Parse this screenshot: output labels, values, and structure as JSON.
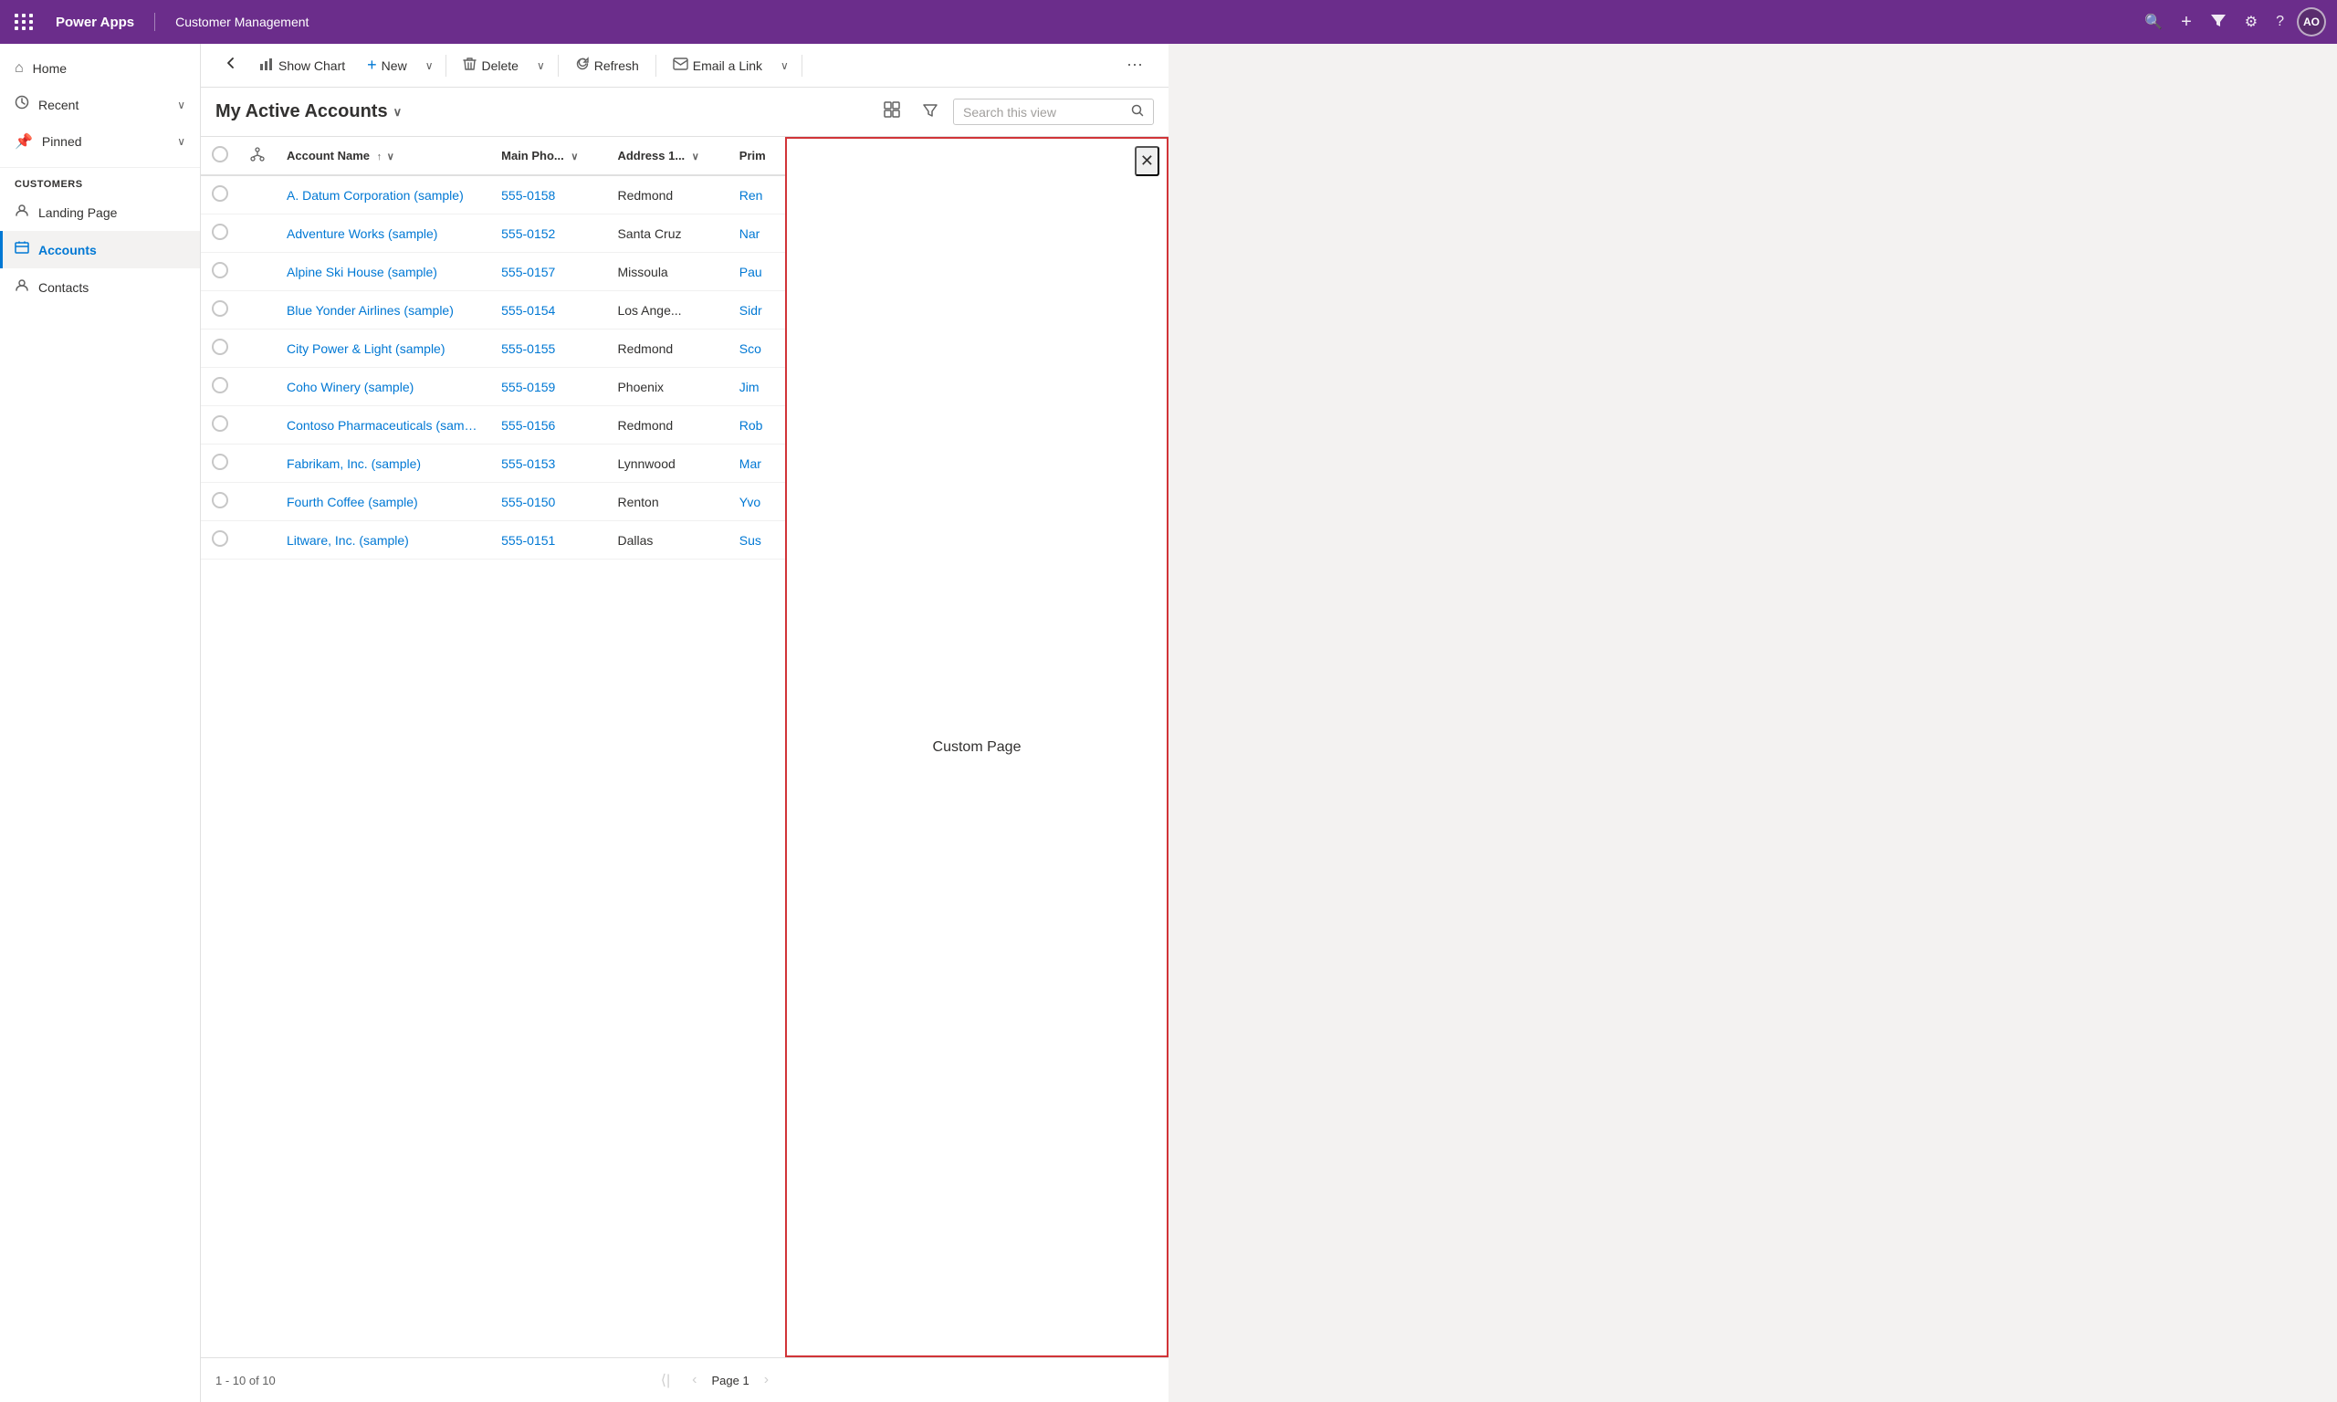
{
  "topBar": {
    "appName": "Power Apps",
    "moduleName": "Customer Management",
    "avatarInitials": "AO",
    "icons": {
      "search": "🔍",
      "add": "+",
      "filter": "⧩",
      "settings": "⚙",
      "help": "?"
    }
  },
  "sidebar": {
    "navItems": [
      {
        "id": "home",
        "label": "Home",
        "icon": "⌂"
      },
      {
        "id": "recent",
        "label": "Recent",
        "icon": "🕐",
        "hasChevron": true
      },
      {
        "id": "pinned",
        "label": "Pinned",
        "icon": "📌",
        "hasChevron": true
      }
    ],
    "sectionLabel": "Customers",
    "subItems": [
      {
        "id": "landing-page",
        "label": "Landing Page",
        "icon": "👤"
      },
      {
        "id": "accounts",
        "label": "Accounts",
        "icon": "📋",
        "active": true
      },
      {
        "id": "contacts",
        "label": "Contacts",
        "icon": "👤"
      }
    ]
  },
  "commandBar": {
    "backLabel": "←",
    "showChartLabel": "Show Chart",
    "newLabel": "New",
    "deleteLabel": "Delete",
    "refreshLabel": "Refresh",
    "emailLinkLabel": "Email a Link",
    "moreLabel": "⋯"
  },
  "viewHeader": {
    "title": "My Active Accounts",
    "chevron": "∨",
    "searchPlaceholder": "Search this view"
  },
  "table": {
    "columns": [
      {
        "id": "check",
        "label": "",
        "type": "check"
      },
      {
        "id": "hier",
        "label": "",
        "type": "hier"
      },
      {
        "id": "accountName",
        "label": "Account Name",
        "sortable": true,
        "sortDir": "asc"
      },
      {
        "id": "mainPhone",
        "label": "Main Pho...",
        "sortable": true
      },
      {
        "id": "address1",
        "label": "Address 1...",
        "sortable": true
      },
      {
        "id": "primary",
        "label": "Prim",
        "sortable": false
      }
    ],
    "rows": [
      {
        "id": 1,
        "accountName": "A. Datum Corporation (sample)",
        "mainPhone": "555-0158",
        "address1": "Redmond",
        "primary": "Ren"
      },
      {
        "id": 2,
        "accountName": "Adventure Works (sample)",
        "mainPhone": "555-0152",
        "address1": "Santa Cruz",
        "primary": "Nar"
      },
      {
        "id": 3,
        "accountName": "Alpine Ski House (sample)",
        "mainPhone": "555-0157",
        "address1": "Missoula",
        "primary": "Pau"
      },
      {
        "id": 4,
        "accountName": "Blue Yonder Airlines (sample)",
        "mainPhone": "555-0154",
        "address1": "Los Ange...",
        "primary": "Sidr"
      },
      {
        "id": 5,
        "accountName": "City Power & Light (sample)",
        "mainPhone": "555-0155",
        "address1": "Redmond",
        "primary": "Sco"
      },
      {
        "id": 6,
        "accountName": "Coho Winery (sample)",
        "mainPhone": "555-0159",
        "address1": "Phoenix",
        "primary": "Jim"
      },
      {
        "id": 7,
        "accountName": "Contoso Pharmaceuticals (sample)",
        "mainPhone": "555-0156",
        "address1": "Redmond",
        "primary": "Rob"
      },
      {
        "id": 8,
        "accountName": "Fabrikam, Inc. (sample)",
        "mainPhone": "555-0153",
        "address1": "Lynnwood",
        "primary": "Mar"
      },
      {
        "id": 9,
        "accountName": "Fourth Coffee (sample)",
        "mainPhone": "555-0150",
        "address1": "Renton",
        "primary": "Yvo"
      },
      {
        "id": 10,
        "accountName": "Litware, Inc. (sample)",
        "mainPhone": "555-0151",
        "address1": "Dallas",
        "primary": "Sus"
      }
    ]
  },
  "footer": {
    "recordCount": "1 - 10 of 10",
    "pageLabel": "Page 1"
  },
  "customPanel": {
    "label": "Custom Page",
    "closeIcon": "✕"
  }
}
